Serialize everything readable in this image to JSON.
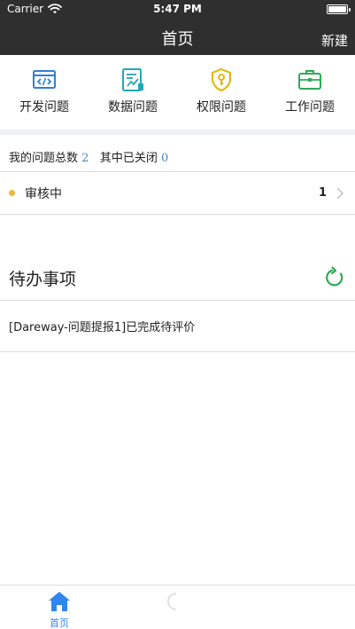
{
  "status_bar": {
    "carrier": "Carrier",
    "time": "5:47 PM"
  },
  "nav": {
    "title": "首页",
    "new_button": "新建"
  },
  "categories": [
    {
      "label": "开发问题",
      "icon": "code-window-icon",
      "color": "#2f7fd8"
    },
    {
      "label": "数据问题",
      "icon": "data-chart-icon",
      "color": "#25a6b8"
    },
    {
      "label": "权限问题",
      "icon": "shield-key-icon",
      "color": "#e2b400"
    },
    {
      "label": "工作问题",
      "icon": "briefcase-icon",
      "color": "#2faa53"
    }
  ],
  "stats": {
    "total_label": "我的问题总数",
    "total": "2",
    "closed_label": "其中已关闭",
    "closed": "0"
  },
  "review": {
    "label": "审核中",
    "count": "1"
  },
  "todo": {
    "title": "待办事项",
    "items": [
      {
        "text": "[Dareway-问题提报1]已完成待评价"
      }
    ]
  },
  "tabs": [
    {
      "label": "首页",
      "active": true
    },
    {
      "label": "",
      "active": false
    }
  ],
  "colors": {
    "header": "#2f2f2f",
    "accent": "#2f86f0",
    "number": "#4a88c9",
    "pending_dot": "#f2b737"
  }
}
